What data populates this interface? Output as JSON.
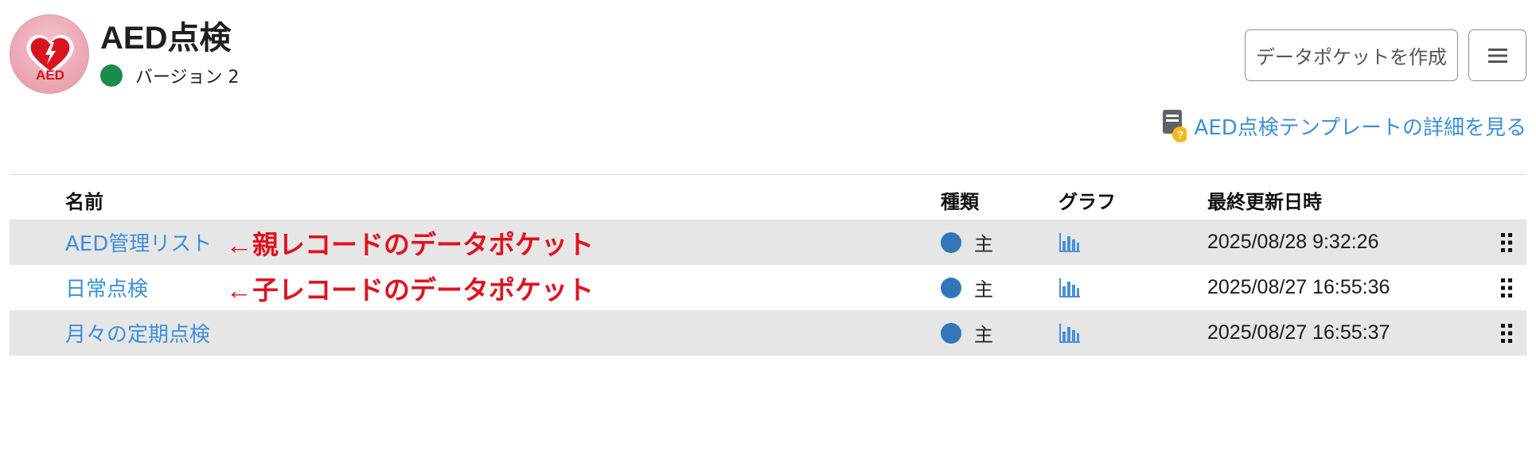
{
  "header": {
    "logo_text": "AED",
    "title": "AED点検",
    "version_label": "バージョン 2",
    "create_button_label": "データポケットを作成",
    "template_link_label": "AED点検テンプレートの詳細を見る",
    "icons": {
      "logo": "aed-heart-icon",
      "menu": "hamburger-menu-icon",
      "template": "document-help-icon"
    },
    "colors": {
      "version_dot": "#1b8a4f",
      "link": "#3d8fd8"
    }
  },
  "table": {
    "columns": [
      "名前",
      "種類",
      "グラフ",
      "最終更新日時"
    ],
    "rows": [
      {
        "name": "AED管理リスト",
        "annotation": "←親レコードのデータポケット",
        "kind": "主",
        "updated": "2025/08/28 9:32:26",
        "graph_icon": "bar-chart-icon",
        "action_icon": "drag-handle-icon"
      },
      {
        "name": "日常点検",
        "annotation": "←子レコードのデータポケット",
        "kind": "主",
        "updated": "2025/08/27 16:55:36",
        "graph_icon": "bar-chart-icon",
        "action_icon": "drag-handle-icon"
      },
      {
        "name": "月々の定期点検",
        "annotation": "",
        "kind": "主",
        "updated": "2025/08/27 16:55:37",
        "graph_icon": "bar-chart-icon",
        "action_icon": "drag-handle-icon"
      }
    ],
    "colors": {
      "kind_dot": "#3475b8",
      "annotation": "#e0121e",
      "row_shade": "#e6e6e6"
    }
  }
}
